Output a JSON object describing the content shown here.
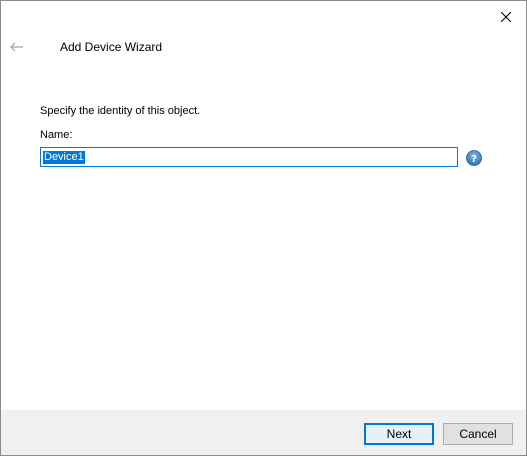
{
  "window": {
    "title": "Add Device Wizard"
  },
  "icons": {
    "close": "close-icon",
    "back": "back-arrow-icon",
    "help": "help-icon"
  },
  "form": {
    "instruction": "Specify the identity of this object.",
    "name_label": "Name:",
    "name_value": "Device1"
  },
  "buttons": {
    "next_label": "Next",
    "cancel_label": "Cancel"
  },
  "colors": {
    "accent": "#0078d7",
    "footer_bg": "#f0f0f0"
  }
}
